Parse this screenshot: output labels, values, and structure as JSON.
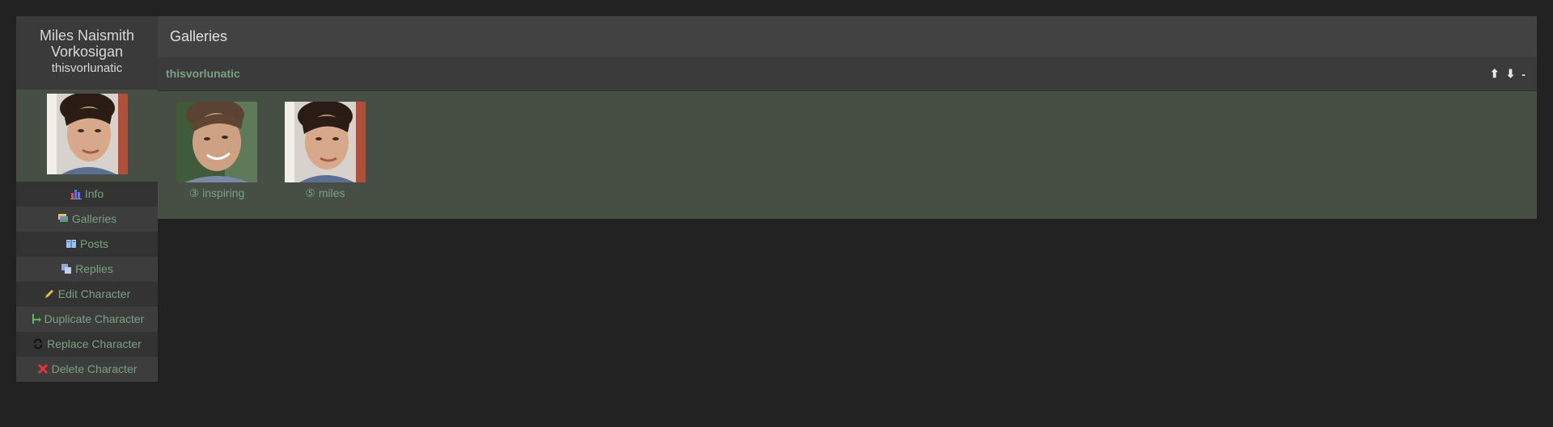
{
  "character": {
    "name": "Miles Naismith Vorkosigan",
    "screenname": "thisvorlunatic"
  },
  "nav": [
    {
      "label": "Info",
      "icon": "chart-icon"
    },
    {
      "label": "Galleries",
      "icon": "galleries-icon"
    },
    {
      "label": "Posts",
      "icon": "book-icon"
    },
    {
      "label": "Replies",
      "icon": "replies-icon"
    },
    {
      "label": "Edit Character",
      "icon": "pencil-icon"
    },
    {
      "label": "Duplicate Character",
      "icon": "duplicate-icon"
    },
    {
      "label": "Replace Character",
      "icon": "replace-icon"
    },
    {
      "label": "Delete Character",
      "icon": "delete-icon"
    }
  ],
  "main": {
    "title": "Galleries"
  },
  "gallery": {
    "name": "thisvorlunatic",
    "controls": {
      "up": "⬆",
      "down": "⬇",
      "collapse": "-"
    },
    "icons": [
      {
        "label": "③ inspiring"
      },
      {
        "label": "⑤ miles"
      }
    ]
  },
  "colors": {
    "background": "#222222",
    "link": "#7aa183",
    "gallery_body": "#474f44"
  }
}
